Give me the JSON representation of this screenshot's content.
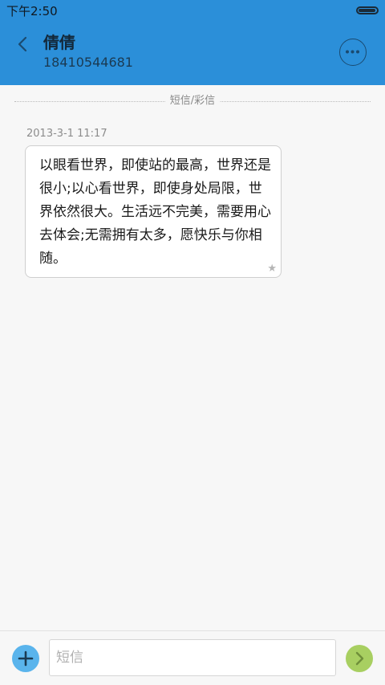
{
  "status_bar": {
    "time": "下午2:50"
  },
  "header": {
    "contact_name": "倩倩",
    "contact_number": "18410544681",
    "back_icon": "chevron-left-icon",
    "more_icon": "more-horizontal-icon"
  },
  "thread": {
    "divider_label": "短信/彩信",
    "messages": [
      {
        "timestamp": "2013-3-1 11:17",
        "text": "以眼看世界，即使站的最高，世界还是很小;以心看世界，即使身处局限，世界依然很大。生活远不完美，需要用心去体会;无需拥有太多，愿快乐与你相随。",
        "star_icon": "star-icon"
      }
    ]
  },
  "composer": {
    "placeholder": "短信",
    "value": "",
    "add_icon": "plus-icon",
    "send_icon": "chevron-right-icon"
  },
  "colors": {
    "header_bg": "#2b8fd9",
    "add_button": "#5ab4ec",
    "send_button": "#a8cf61",
    "background": "#f7f7f7"
  }
}
